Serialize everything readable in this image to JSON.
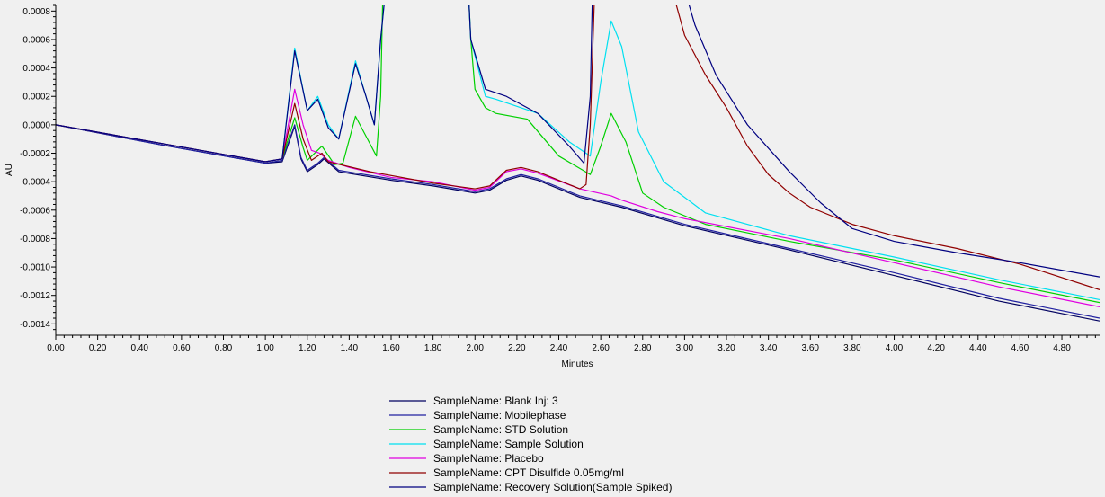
{
  "chart_data": {
    "type": "line",
    "xlabel": "Minutes",
    "ylabel": "AU",
    "xlim": [
      0.0,
      4.98
    ],
    "ylim": [
      -0.00148,
      0.00084
    ],
    "x_ticks": [
      "0.00",
      "0.20",
      "0.40",
      "0.60",
      "0.80",
      "1.00",
      "1.20",
      "1.40",
      "1.60",
      "1.80",
      "2.00",
      "2.20",
      "2.40",
      "2.60",
      "2.80",
      "3.00",
      "3.20",
      "3.40",
      "3.60",
      "3.80",
      "4.00",
      "4.20",
      "4.40",
      "4.60",
      "4.80"
    ],
    "y_ticks": [
      "0.0008",
      "0.0006",
      "0.0004",
      "0.0002",
      "0.0000",
      "-0.0002",
      "-0.0004",
      "-0.0006",
      "-0.0008",
      "-0.0010",
      "-0.0012",
      "-0.0014"
    ],
    "grid": false,
    "legend_position": "bottom-center",
    "series": [
      {
        "name": "SampleName: Blank Inj: 3",
        "color": "#000060",
        "points": [
          [
            0.0,
            0.0
          ],
          [
            0.5,
            -0.00014
          ],
          [
            1.0,
            -0.00027
          ],
          [
            1.08,
            -0.00026
          ],
          [
            1.14,
            -1e-05
          ],
          [
            1.17,
            -0.00024
          ],
          [
            1.2,
            -0.00033
          ],
          [
            1.25,
            -0.00028
          ],
          [
            1.28,
            -0.00024
          ],
          [
            1.35,
            -0.00033
          ],
          [
            1.6,
            -0.00039
          ],
          [
            1.8,
            -0.00043
          ],
          [
            2.0,
            -0.00048
          ],
          [
            2.07,
            -0.00046
          ],
          [
            2.15,
            -0.00039
          ],
          [
            2.22,
            -0.00036
          ],
          [
            2.3,
            -0.00039
          ],
          [
            2.5,
            -0.00051
          ],
          [
            2.7,
            -0.00058
          ],
          [
            3.0,
            -0.00071
          ],
          [
            3.5,
            -0.00088
          ],
          [
            4.0,
            -0.00106
          ],
          [
            4.5,
            -0.00124
          ],
          [
            4.98,
            -0.00138
          ]
        ]
      },
      {
        "name": "SampleName: Mobilephase",
        "color": "#2020a0",
        "points": [
          [
            0.0,
            0.0
          ],
          [
            0.5,
            -0.00014
          ],
          [
            1.0,
            -0.00027
          ],
          [
            1.08,
            -0.00025
          ],
          [
            1.14,
            0.0
          ],
          [
            1.17,
            -0.00023
          ],
          [
            1.2,
            -0.00032
          ],
          [
            1.25,
            -0.00027
          ],
          [
            1.28,
            -0.00023
          ],
          [
            1.35,
            -0.00032
          ],
          [
            1.6,
            -0.00038
          ],
          [
            1.8,
            -0.00042
          ],
          [
            2.0,
            -0.00047
          ],
          [
            2.07,
            -0.00045
          ],
          [
            2.15,
            -0.00038
          ],
          [
            2.22,
            -0.00035
          ],
          [
            2.3,
            -0.00038
          ],
          [
            2.5,
            -0.0005
          ],
          [
            2.7,
            -0.00057
          ],
          [
            3.0,
            -0.0007
          ],
          [
            3.5,
            -0.00087
          ],
          [
            4.0,
            -0.00104
          ],
          [
            4.5,
            -0.00122
          ],
          [
            4.98,
            -0.00136
          ]
        ]
      },
      {
        "name": "SampleName: STD Solution",
        "color": "#00d000",
        "points": [
          [
            0.0,
            0.0
          ],
          [
            0.5,
            -0.00013
          ],
          [
            1.0,
            -0.00026
          ],
          [
            1.08,
            -0.00024
          ],
          [
            1.14,
            5e-05
          ],
          [
            1.18,
            -0.00016
          ],
          [
            1.2,
            -0.00025
          ],
          [
            1.27,
            -0.00015
          ],
          [
            1.33,
            -0.00028
          ],
          [
            1.37,
            -0.00027
          ],
          [
            1.43,
            6e-05
          ],
          [
            1.48,
            -8e-05
          ],
          [
            1.53,
            -0.00022
          ],
          [
            1.55,
            0.0002
          ],
          [
            1.56,
            0.0009
          ],
          [
            1.97,
            0.0009
          ],
          [
            1.98,
            0.0006
          ],
          [
            2.0,
            0.00025
          ],
          [
            2.05,
            0.00012
          ],
          [
            2.1,
            8e-05
          ],
          [
            2.25,
            4e-05
          ],
          [
            2.4,
            -0.00022
          ],
          [
            2.55,
            -0.00035
          ],
          [
            2.6,
            -0.00015
          ],
          [
            2.65,
            8e-05
          ],
          [
            2.72,
            -0.00012
          ],
          [
            2.8,
            -0.00048
          ],
          [
            2.9,
            -0.00058
          ],
          [
            3.1,
            -0.0007
          ],
          [
            3.5,
            -0.00082
          ],
          [
            4.0,
            -0.00095
          ],
          [
            4.5,
            -0.00111
          ],
          [
            4.98,
            -0.00125
          ]
        ]
      },
      {
        "name": "SampleName: Sample Solution",
        "color": "#00e0f0",
        "points": [
          [
            0.0,
            0.0
          ],
          [
            0.5,
            -0.00013
          ],
          [
            1.0,
            -0.00026
          ],
          [
            1.08,
            -0.00024
          ],
          [
            1.14,
            0.00054
          ],
          [
            1.2,
            0.0001
          ],
          [
            1.25,
            0.0002
          ],
          [
            1.3,
            0.0
          ],
          [
            1.35,
            -0.0001
          ],
          [
            1.43,
            0.00045
          ],
          [
            1.48,
            0.0002
          ],
          [
            1.52,
            0.0
          ],
          [
            1.55,
            0.0006
          ],
          [
            1.57,
            0.0009
          ],
          [
            1.97,
            0.0009
          ],
          [
            1.98,
            0.0006
          ],
          [
            2.05,
            0.0002
          ],
          [
            2.1,
            0.00018
          ],
          [
            2.3,
            8e-05
          ],
          [
            2.45,
            -0.00012
          ],
          [
            2.55,
            -0.00022
          ],
          [
            2.6,
            0.0003
          ],
          [
            2.65,
            0.00073
          ],
          [
            2.7,
            0.00055
          ],
          [
            2.78,
            -5e-05
          ],
          [
            2.9,
            -0.0004
          ],
          [
            3.1,
            -0.00062
          ],
          [
            3.5,
            -0.00078
          ],
          [
            4.0,
            -0.00093
          ],
          [
            4.5,
            -0.00109
          ],
          [
            4.98,
            -0.00123
          ]
        ]
      },
      {
        "name": "SampleName: Placebo",
        "color": "#e000e0",
        "points": [
          [
            0.0,
            0.0
          ],
          [
            0.5,
            -0.00013
          ],
          [
            1.0,
            -0.00026
          ],
          [
            1.08,
            -0.00024
          ],
          [
            1.14,
            0.00025
          ],
          [
            1.18,
            0.0
          ],
          [
            1.22,
            -0.00018
          ],
          [
            1.26,
            -0.0002
          ],
          [
            1.3,
            -0.00025
          ],
          [
            1.4,
            -0.0003
          ],
          [
            1.6,
            -0.00037
          ],
          [
            1.8,
            -0.0004
          ],
          [
            2.0,
            -0.00046
          ],
          [
            2.07,
            -0.00044
          ],
          [
            2.15,
            -0.00033
          ],
          [
            2.22,
            -0.00031
          ],
          [
            2.3,
            -0.00034
          ],
          [
            2.5,
            -0.00045
          ],
          [
            2.65,
            -0.0005
          ],
          [
            2.7,
            -0.00053
          ],
          [
            2.87,
            -0.00061
          ],
          [
            3.0,
            -0.00066
          ],
          [
            3.5,
            -0.0008
          ],
          [
            4.0,
            -0.00097
          ],
          [
            4.5,
            -0.00114
          ],
          [
            4.98,
            -0.00128
          ]
        ]
      },
      {
        "name": "SampleName: CPT Disulfide 0.05mg/ml",
        "color": "#900000",
        "points": [
          [
            0.0,
            0.0
          ],
          [
            0.5,
            -0.00013
          ],
          [
            1.0,
            -0.00026
          ],
          [
            1.08,
            -0.00024
          ],
          [
            1.14,
            0.00015
          ],
          [
            1.18,
            -0.0001
          ],
          [
            1.22,
            -0.00025
          ],
          [
            1.27,
            -0.0002
          ],
          [
            1.3,
            -0.00026
          ],
          [
            1.5,
            -0.00033
          ],
          [
            1.8,
            -0.00041
          ],
          [
            2.0,
            -0.00045
          ],
          [
            2.07,
            -0.00043
          ],
          [
            2.15,
            -0.00032
          ],
          [
            2.22,
            -0.0003
          ],
          [
            2.3,
            -0.00033
          ],
          [
            2.5,
            -0.00045
          ],
          [
            2.53,
            -0.00042
          ],
          [
            2.55,
            0.0
          ],
          [
            2.57,
            0.0009
          ],
          [
            2.95,
            0.0009
          ],
          [
            3.0,
            0.00063
          ],
          [
            3.1,
            0.00035
          ],
          [
            3.2,
            0.00012
          ],
          [
            3.3,
            -0.00015
          ],
          [
            3.4,
            -0.00035
          ],
          [
            3.5,
            -0.00048
          ],
          [
            3.6,
            -0.00058
          ],
          [
            3.8,
            -0.0007
          ],
          [
            4.0,
            -0.00078
          ],
          [
            4.3,
            -0.00087
          ],
          [
            4.6,
            -0.00098
          ],
          [
            4.98,
            -0.00116
          ]
        ]
      },
      {
        "name": "SampleName: Recovery Solution(Sample Spiked)",
        "color": "#000080",
        "points": [
          [
            0.0,
            0.0
          ],
          [
            0.5,
            -0.00013
          ],
          [
            1.0,
            -0.00026
          ],
          [
            1.08,
            -0.00024
          ],
          [
            1.14,
            0.00052
          ],
          [
            1.2,
            0.0001
          ],
          [
            1.25,
            0.00018
          ],
          [
            1.3,
            -2e-05
          ],
          [
            1.35,
            -0.0001
          ],
          [
            1.43,
            0.00043
          ],
          [
            1.48,
            0.0002
          ],
          [
            1.52,
            0.0
          ],
          [
            1.55,
            0.0006
          ],
          [
            1.57,
            0.0009
          ],
          [
            1.97,
            0.0009
          ],
          [
            1.98,
            0.0006
          ],
          [
            2.05,
            0.00025
          ],
          [
            2.15,
            0.0002
          ],
          [
            2.3,
            8e-05
          ],
          [
            2.45,
            -0.00015
          ],
          [
            2.52,
            -0.00027
          ],
          [
            2.55,
            0.0002
          ],
          [
            2.56,
            0.0009
          ],
          [
            3.01,
            0.0009
          ],
          [
            3.05,
            0.0007
          ],
          [
            3.15,
            0.00035
          ],
          [
            3.3,
            0.0
          ],
          [
            3.5,
            -0.00033
          ],
          [
            3.65,
            -0.00055
          ],
          [
            3.8,
            -0.00073
          ],
          [
            4.0,
            -0.00082
          ],
          [
            4.3,
            -0.0009
          ],
          [
            4.6,
            -0.00097
          ],
          [
            4.98,
            -0.00107
          ]
        ]
      }
    ]
  }
}
